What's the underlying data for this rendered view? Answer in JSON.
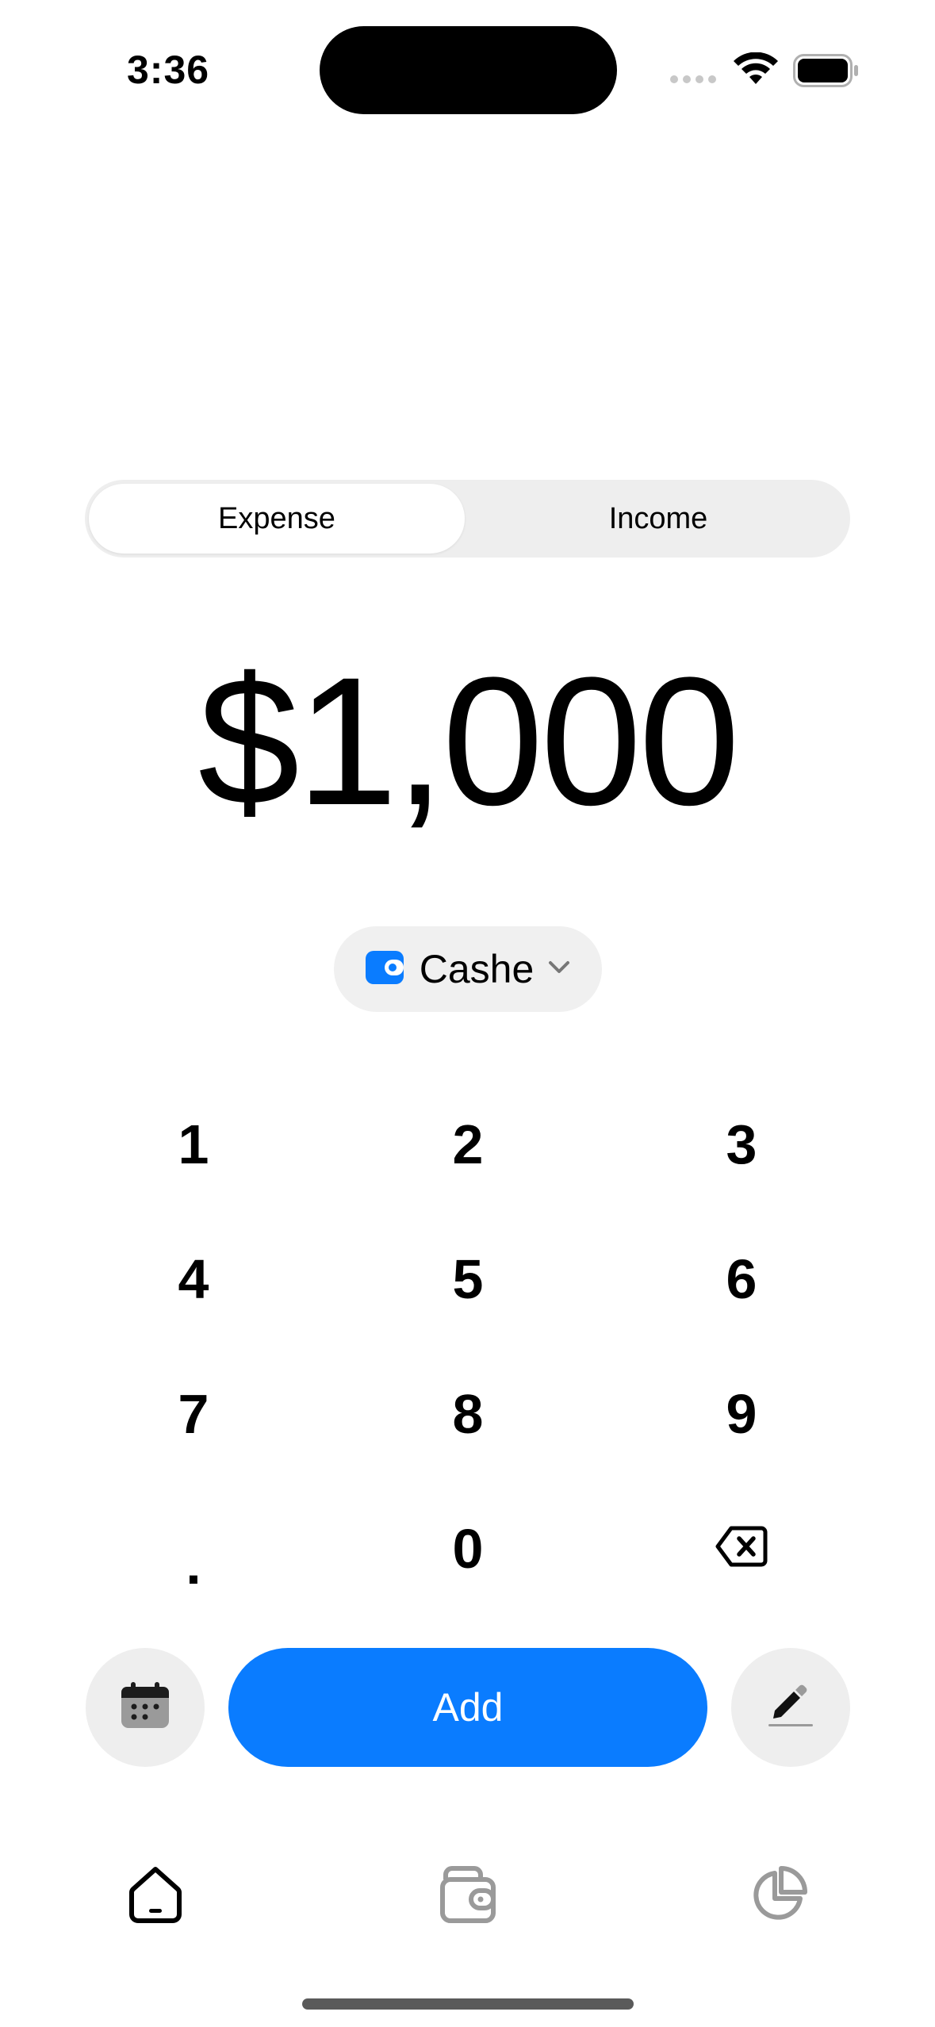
{
  "status_bar": {
    "time": "3:36"
  },
  "segment": {
    "expense_label": "Expense",
    "income_label": "Income",
    "selected": "Expense"
  },
  "amount": {
    "value": "$1,000"
  },
  "account": {
    "label": "Cashe",
    "icon": "wallet-icon",
    "accent": "#0a7cff"
  },
  "keypad": {
    "row1": [
      "1",
      "2",
      "3"
    ],
    "row2": [
      "4",
      "5",
      "6"
    ],
    "row3": [
      "7",
      "8",
      "9"
    ],
    "row4": [
      ".",
      "0",
      "backspace-icon"
    ]
  },
  "actions": {
    "add_label": "Add",
    "left_icon": "calendar-icon",
    "right_icon": "pencil-icon"
  },
  "tab_bar": {
    "items": [
      {
        "icon": "home-icon",
        "active": true
      },
      {
        "icon": "wallet-icon",
        "active": false
      },
      {
        "icon": "pie-chart-icon",
        "active": false
      }
    ]
  },
  "colors": {
    "accent": "#0a7cff",
    "pill_bg": "#eeeeee"
  }
}
